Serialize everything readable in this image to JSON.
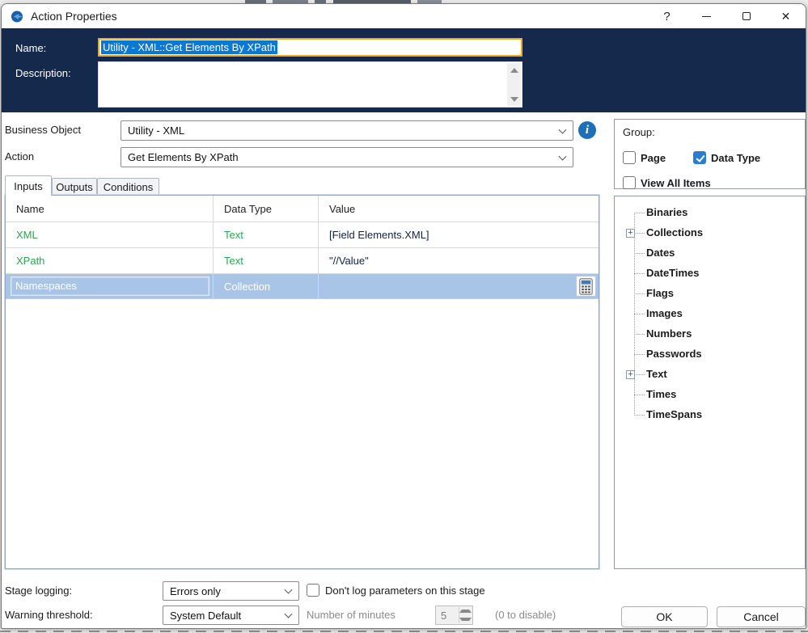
{
  "window": {
    "title": "Action Properties",
    "help_glyph": "?",
    "close_glyph": "✕"
  },
  "header": {
    "name_label": "Name:",
    "name_value": "Utility - XML::Get Elements By XPath",
    "description_label": "Description:",
    "description_value": ""
  },
  "selectors": {
    "business_object_label": "Business Object",
    "business_object_value": "Utility - XML",
    "action_label": "Action",
    "action_value": "Get Elements By XPath"
  },
  "tabs": [
    {
      "label": "Inputs",
      "active": true
    },
    {
      "label": "Outputs",
      "active": false
    },
    {
      "label": "Conditions",
      "active": false
    }
  ],
  "inputs_table": {
    "columns": [
      "Name",
      "Data Type",
      "Value"
    ],
    "rows": [
      {
        "name": "XML",
        "data_type": "Text",
        "value": "[Field Elements.XML]",
        "selected": false
      },
      {
        "name": "XPath",
        "data_type": "Text",
        "value": "\"//Value\"",
        "selected": false
      },
      {
        "name": "Namespaces",
        "data_type": "Collection",
        "value": "",
        "selected": true
      }
    ]
  },
  "group_panel": {
    "title": "Group:",
    "checkboxes": [
      {
        "label": "Page",
        "checked": false
      },
      {
        "label": "Data Type",
        "checked": true
      },
      {
        "label": "View All Items",
        "checked": false
      }
    ]
  },
  "data_tree": {
    "items": [
      {
        "label": "Binaries",
        "expandable": false
      },
      {
        "label": "Collections",
        "expandable": true
      },
      {
        "label": "Dates",
        "expandable": false
      },
      {
        "label": "DateTimes",
        "expandable": false
      },
      {
        "label": "Flags",
        "expandable": false
      },
      {
        "label": "Images",
        "expandable": false
      },
      {
        "label": "Numbers",
        "expandable": false
      },
      {
        "label": "Passwords",
        "expandable": false
      },
      {
        "label": "Text",
        "expandable": true
      },
      {
        "label": "Times",
        "expandable": false
      },
      {
        "label": "TimeSpans",
        "expandable": false
      }
    ]
  },
  "footer": {
    "stage_logging_label": "Stage logging:",
    "stage_logging_value": "Errors only",
    "dont_log_label": "Don't log parameters on this stage",
    "dont_log_checked": false,
    "warning_threshold_label": "Warning threshold:",
    "warning_threshold_value": "System Default",
    "minutes_label": "Number of minutes",
    "minutes_value": "5",
    "disable_hint": "(0 to disable)",
    "ok_label": "OK",
    "cancel_label": "Cancel"
  },
  "colors": {
    "navy_header": "#14294b",
    "gold_focus_border": "#f0a81e",
    "selection_blue": "#0a78d7",
    "row_selected_blue": "#a8c5e8",
    "param_green": "#2aa64c",
    "info_icon_blue": "#1d6fb8",
    "checkbox_checked_blue": "#2b7cd3"
  }
}
